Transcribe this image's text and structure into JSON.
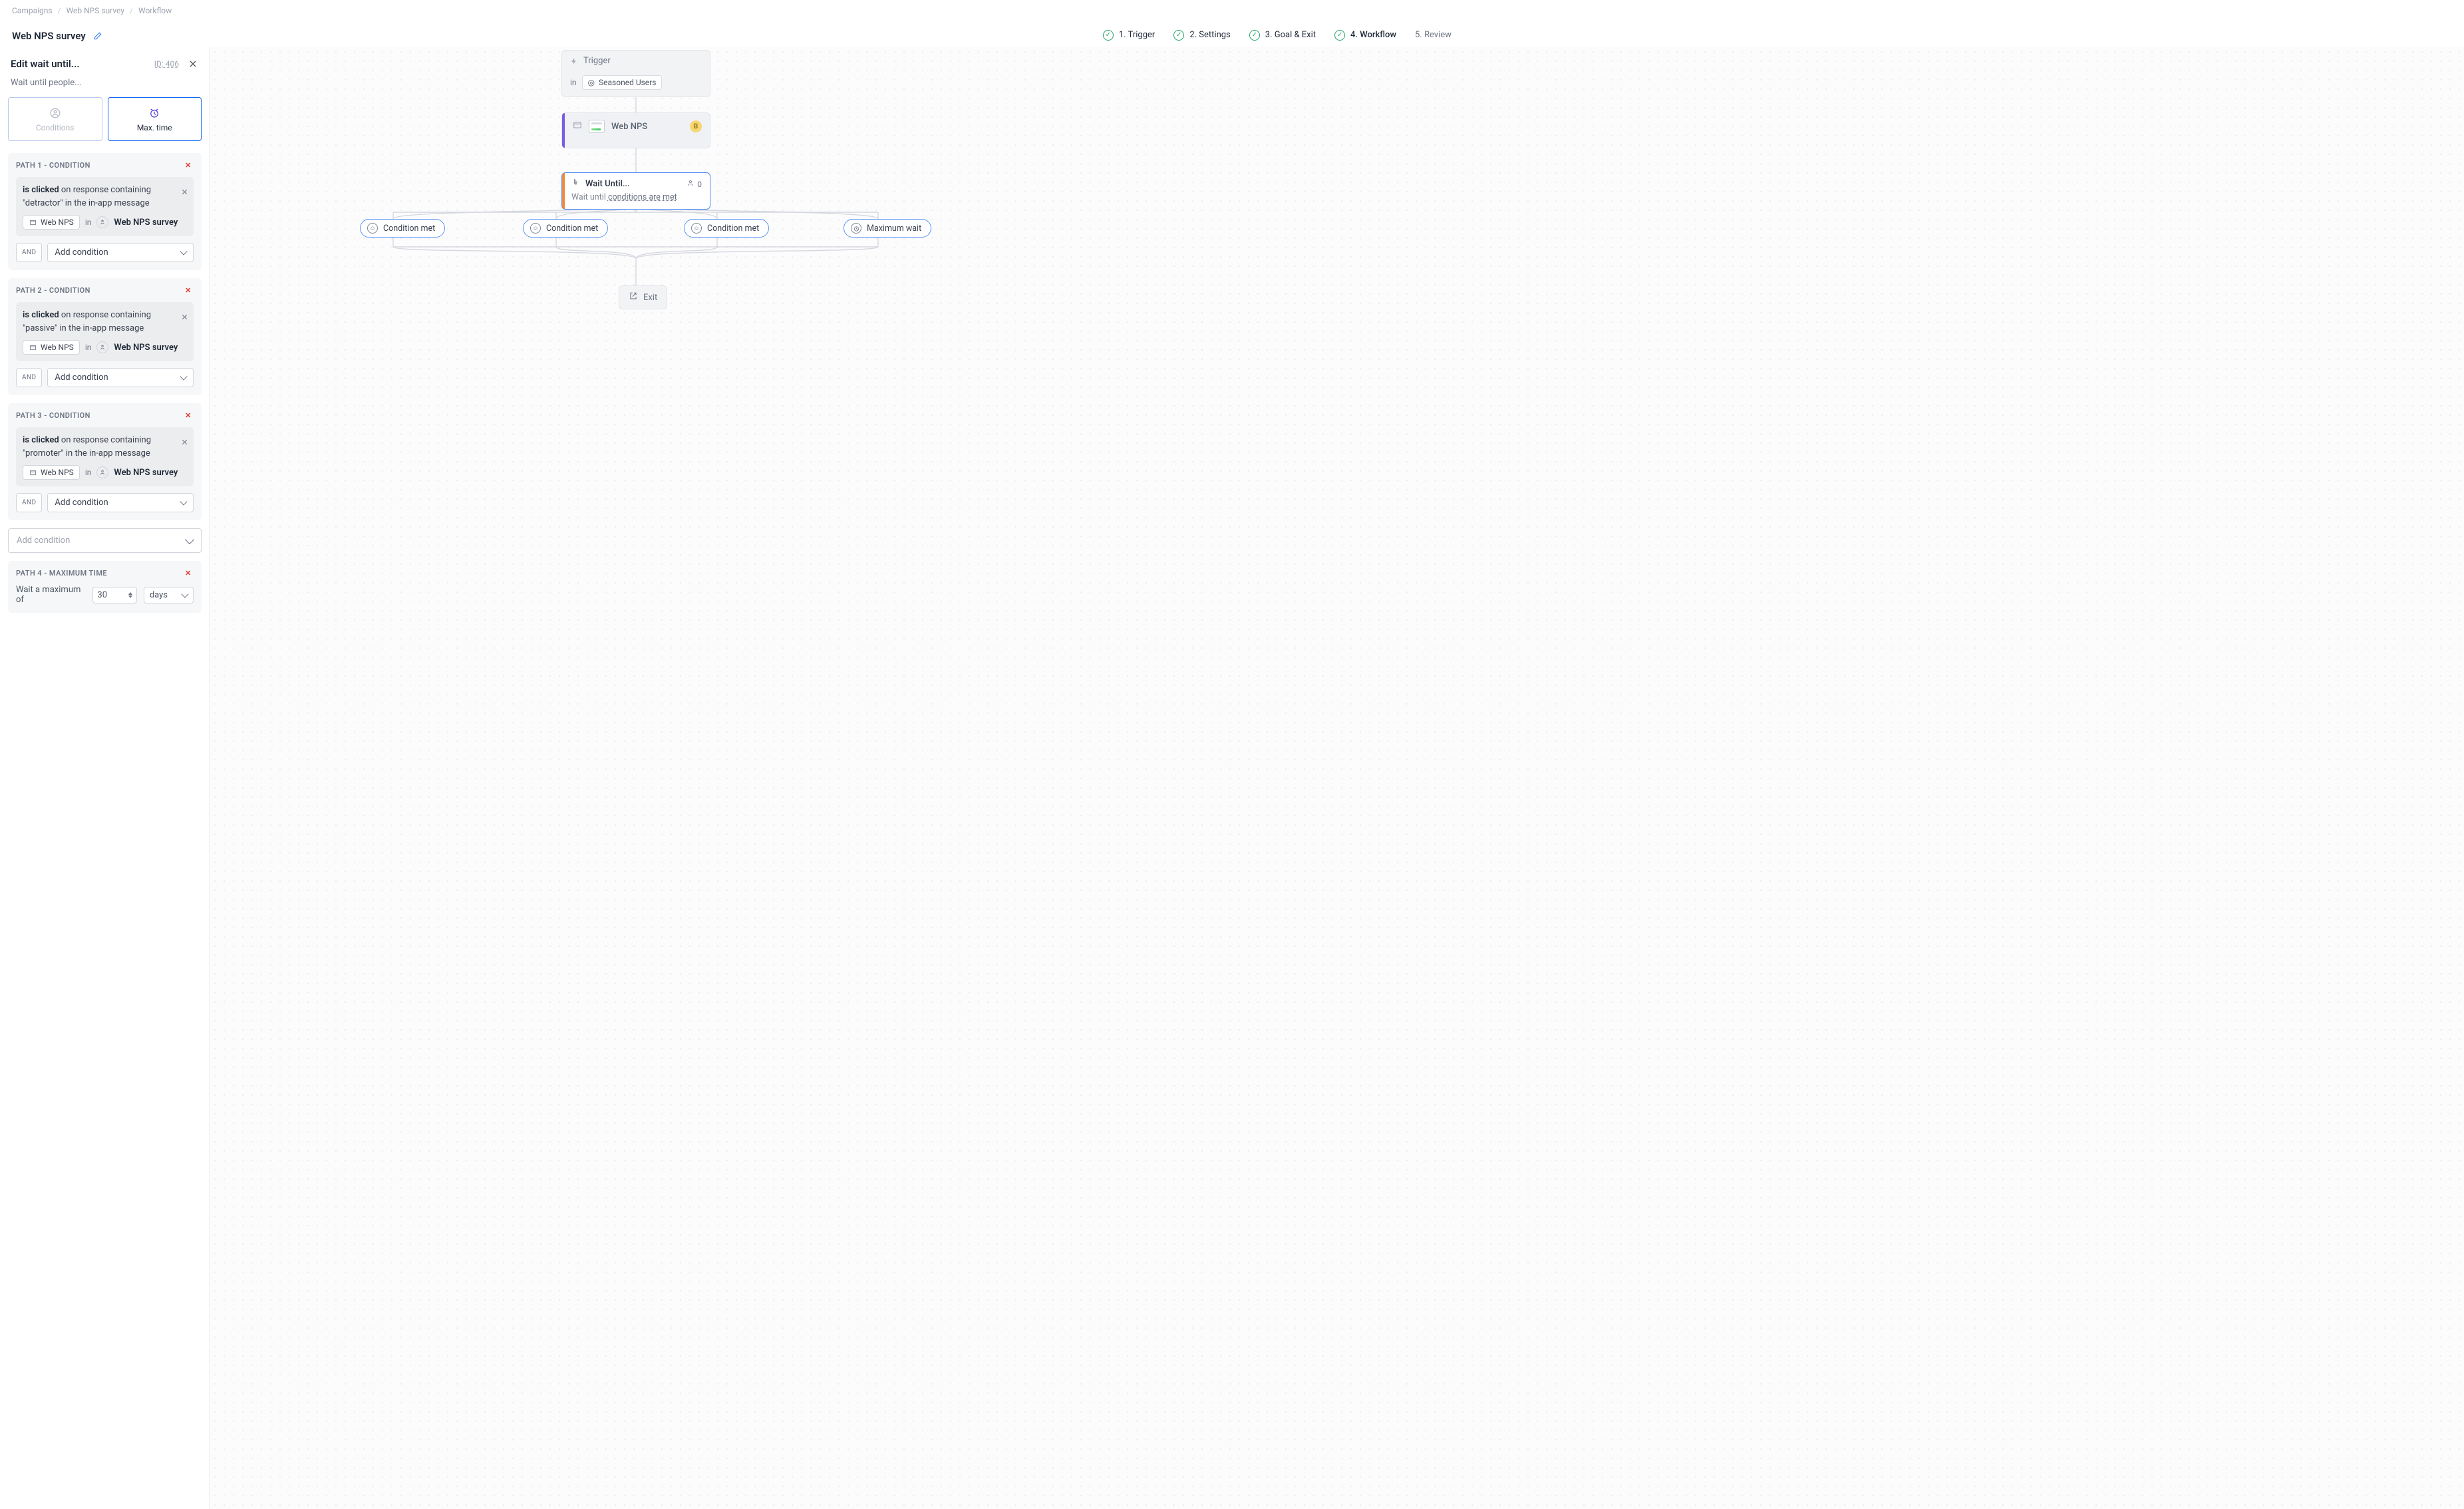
{
  "breadcrumb": {
    "root": "Campaigns",
    "mid": "Web NPS survey",
    "leaf": "Workflow"
  },
  "title": "Web NPS survey",
  "steps": {
    "s1": "1. Trigger",
    "s2": "2. Settings",
    "s3": "3. Goal & Exit",
    "s4": "4. Workflow",
    "s5": "5. Review"
  },
  "sidebar": {
    "heading": "Edit wait until...",
    "id_label": "ID: 406",
    "subline": "Wait until people...",
    "seg": {
      "conditions": "Conditions",
      "max": "Max. time"
    },
    "paths": [
      {
        "head": "Path 1 - Condition",
        "prefix": "is clicked",
        "rest": " on response containing \"detractor\" in the in-app message",
        "pill": "Web NPS",
        "in": "in",
        "survey": "Web NPS survey",
        "and": "AND",
        "add": "Add condition"
      },
      {
        "head": "Path 2 - Condition",
        "prefix": "is clicked",
        "rest": " on response containing \"passive\" in the in-app message",
        "pill": "Web NPS",
        "in": "in",
        "survey": "Web NPS survey",
        "and": "AND",
        "add": "Add condition"
      },
      {
        "head": "Path 3 - Condition",
        "prefix": "is clicked",
        "rest": " on response containing \"promoter\" in the in-app message",
        "pill": "Web NPS",
        "in": "in",
        "survey": "Web NPS survey",
        "and": "AND",
        "add": "Add condition"
      }
    ],
    "add_block": "Add condition",
    "maxpath": {
      "head": "Path 4 - Maximum Time",
      "label": "Wait a maximum of",
      "value": "30",
      "unit": "days"
    }
  },
  "canvas": {
    "trigger": {
      "title": "Trigger",
      "in": "in",
      "segment": "Seasoned Users"
    },
    "msg": {
      "title": "Web NPS"
    },
    "wait": {
      "title": "Wait Until...",
      "count": "0",
      "sub_pre": "Wait until ",
      "sub_u": "conditions are met"
    },
    "chips": {
      "c1": "Condition met",
      "c2": "Condition met",
      "c3": "Condition met",
      "c4": "Maximum wait"
    },
    "exit": "Exit"
  }
}
